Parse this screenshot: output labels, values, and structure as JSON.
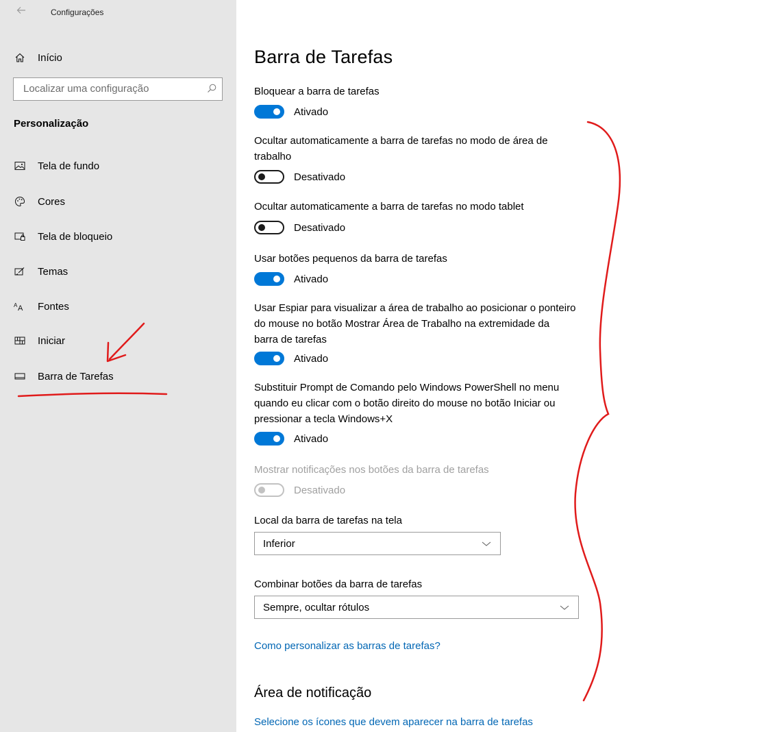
{
  "window": {
    "app_title": "Configurações"
  },
  "sidebar": {
    "home_label": "Início",
    "search_placeholder": "Localizar uma configuração",
    "section_title": "Personalização",
    "items": [
      {
        "label": "Tela de fundo",
        "icon": "picture-icon"
      },
      {
        "label": "Cores",
        "icon": "palette-icon"
      },
      {
        "label": "Tela de bloqueio",
        "icon": "lock-screen-icon"
      },
      {
        "label": "Temas",
        "icon": "brush-icon"
      },
      {
        "label": "Fontes",
        "icon": "font-icon"
      },
      {
        "label": "Iniciar",
        "icon": "start-grid-icon"
      },
      {
        "label": "Barra de Tarefas",
        "icon": "taskbar-icon"
      }
    ]
  },
  "main": {
    "title": "Barra de Tarefas",
    "settings": [
      {
        "label": "Bloquear a barra de tarefas",
        "state": "Ativado",
        "on": true
      },
      {
        "label": "Ocultar automaticamente a barra de tarefas no modo de área de trabalho",
        "state": "Desativado",
        "on": false
      },
      {
        "label": "Ocultar automaticamente a barra de tarefas no modo tablet",
        "state": "Desativado",
        "on": false
      },
      {
        "label": "Usar botões pequenos da barra de tarefas",
        "state": "Ativado",
        "on": true
      },
      {
        "label": "Usar Espiar para visualizar a área de trabalho ao posicionar o ponteiro do mouse no botão Mostrar Área de Trabalho na extremidade da barra de tarefas",
        "state": "Ativado",
        "on": true
      },
      {
        "label": "Substituir Prompt de Comando pelo Windows PowerShell no menu quando eu clicar com o botão direito do mouse no botão Iniciar ou pressionar a tecla Windows+X",
        "state": "Ativado",
        "on": true
      },
      {
        "label": "Mostrar notificações nos botões da barra de tarefas",
        "state": "Desativado",
        "on": false,
        "disabled": true
      }
    ],
    "location": {
      "label": "Local da barra de tarefas na tela",
      "value": "Inferior"
    },
    "combine": {
      "label": "Combinar botões da barra de tarefas",
      "value": "Sempre, ocultar rótulos"
    },
    "help_link": "Como personalizar as barras de tarefas?",
    "notification_area": {
      "title": "Área de notificação",
      "link": "Selecione os ícones que devem aparecer na barra de tarefas"
    }
  },
  "colors": {
    "accent": "#0078d7",
    "link": "#0066b4",
    "sidebar_bg": "#e6e6e6",
    "annotation": "#e01b1b"
  }
}
